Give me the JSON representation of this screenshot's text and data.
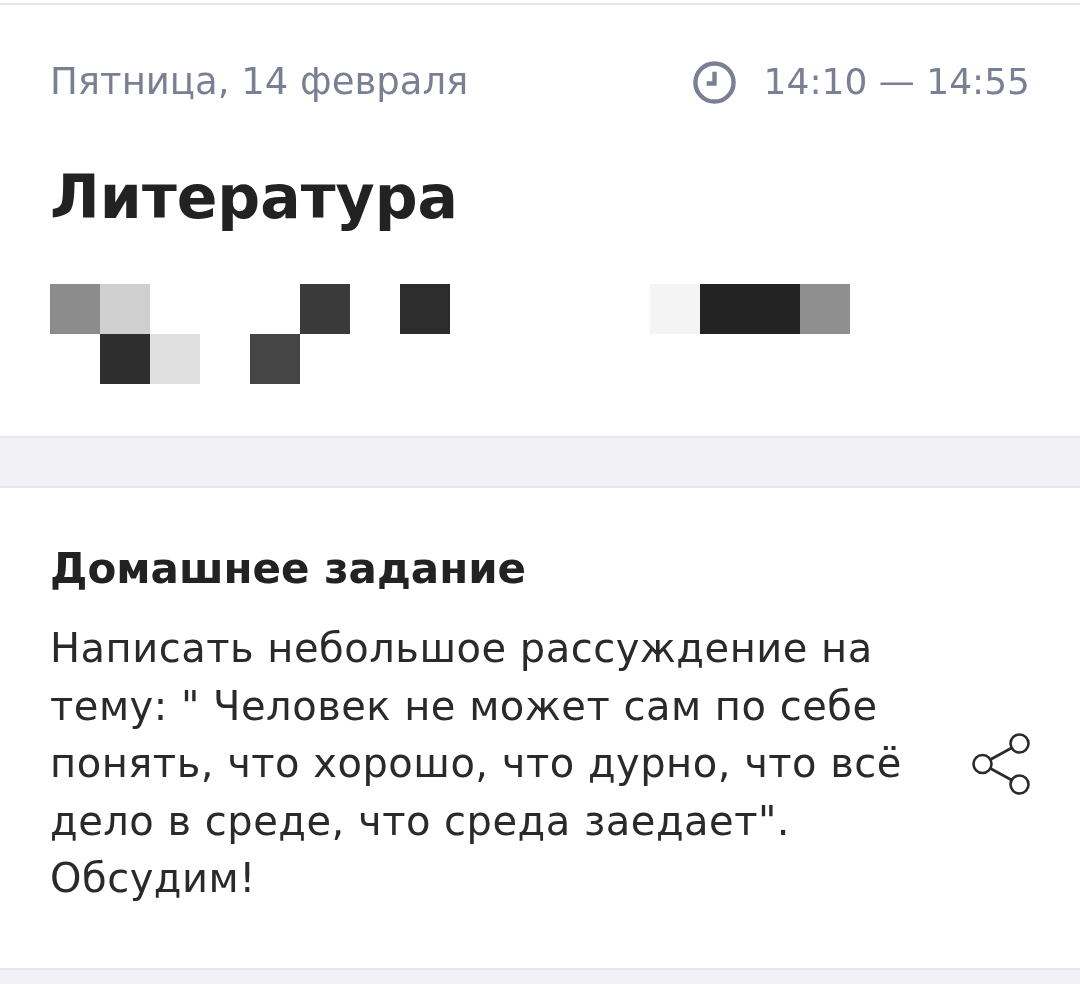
{
  "lesson": {
    "date": "Пятница, 14 февраля",
    "time": "14:10 — 14:55",
    "title": "Литература",
    "redacted_line": true
  },
  "homework": {
    "heading": "Домашнее задание",
    "text": "Написать небольшое рассуждение на тему: \" Человек не может сам по себе понять, что хорошо, что дурно, что всё дело в среде, что среда заедает\". Обсудим!"
  }
}
